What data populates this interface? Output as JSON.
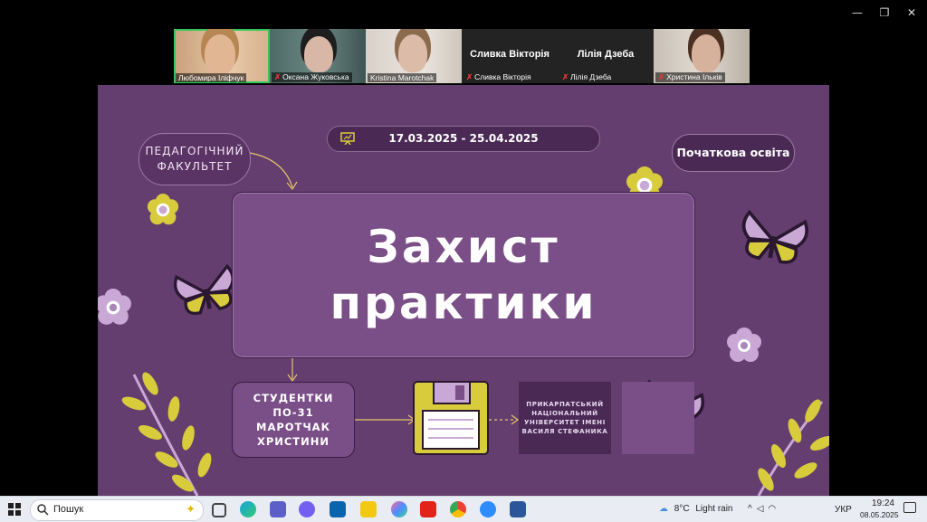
{
  "window_controls": {
    "minimize": "—",
    "restore": "❐",
    "close": "✕"
  },
  "participants": [
    {
      "name": "Любомира Іліфчук",
      "muted": false,
      "type": "video"
    },
    {
      "name": "Оксана Жуковська",
      "muted": true,
      "type": "video"
    },
    {
      "name": "Kristina Marotchak",
      "muted": false,
      "type": "video"
    },
    {
      "name": "Сливка Вікторія",
      "muted": true,
      "type": "name"
    },
    {
      "name": "Лілія Дзеба",
      "muted": true,
      "type": "name"
    },
    {
      "name": "Христина Ільків",
      "muted": true,
      "type": "video"
    }
  ],
  "slide": {
    "dates": "17.03.2025 - 25.04.2025",
    "faculty_line1": "ПЕДАГОГІЧНИЙ",
    "faculty_line2": "ФАКУЛЬТЕТ",
    "program": "Початкова освіта",
    "title_line1": "Захист",
    "title_line2": "практики",
    "student_lines": [
      "СТУДЕНТКИ",
      "ПО-31",
      "МАРОТЧАК",
      "ХРИСТИНИ"
    ],
    "university_lines": [
      "ПРИКАРПАТСЬКИЙ",
      "НАЦІОНАЛЬНИЙ",
      "УНІВЕРСИТЕТ ІМЕНІ",
      "ВАСИЛЯ СТЕФАНИКА"
    ]
  },
  "taskbar": {
    "search_placeholder": "Пошук",
    "weather_temp": "8°C",
    "weather_text": "Light rain",
    "language": "УКР",
    "time": "19:24",
    "date": "08.05.2025"
  },
  "colors": {
    "slide_bg": "#643e6e",
    "accent_yellow": "#d9cc3c",
    "lavender": "#c9a8d6"
  }
}
